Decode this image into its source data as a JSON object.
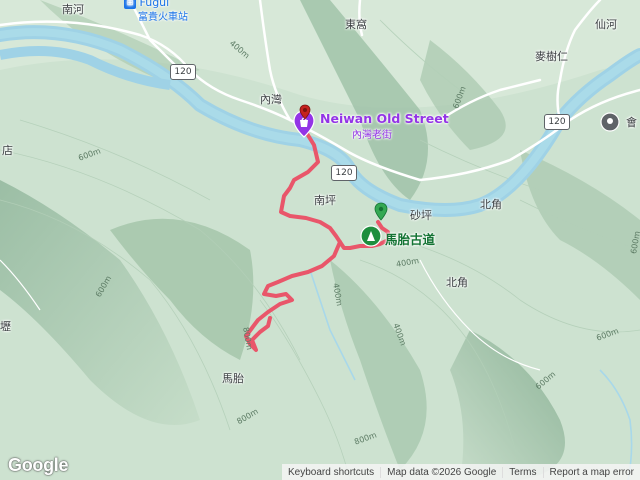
{
  "colors": {
    "trail": "#e9566a",
    "river": "#a8d8ea",
    "road": "#ffffff",
    "poi_accent": "#9334e6",
    "trail_marker": "#1e8e3e"
  },
  "labels": {
    "nanhe": "南河",
    "fugui_en": "Fugui",
    "fugui_zh": "富貴火車站",
    "dongwo": "東窩",
    "xianhe": "仙河",
    "maishuren": "麥樹仁",
    "neiwan": "內灣",
    "neiwan_old_street": "Neiwan Old Street",
    "neiwan_old_street_zh": "內灣老街",
    "nanping": "南坪",
    "shaping": "砂坪",
    "beijiao_1": "北角",
    "beijiao_2": "北角",
    "matai_trail": "馬胎古道",
    "matai": "馬胎",
    "dian": "店",
    "li": "壢",
    "hui": "會"
  },
  "roads": {
    "r120_a": "120",
    "r120_b": "120",
    "r120_c": "120"
  },
  "elevations": [
    "400m",
    "600m",
    "600m",
    "600m",
    "400m",
    "400m",
    "600m",
    "800m",
    "600m",
    "800m",
    "600m",
    "800m",
    "400m"
  ],
  "icons": {
    "train": "train-station-icon",
    "poi": "shopping-pin-icon",
    "trail": "hiking-trail-icon",
    "place": "place-pin-icon"
  },
  "branding": {
    "logo": "Google"
  },
  "attribution": {
    "shortcuts": "Keyboard shortcuts",
    "map_data": "Map data ©2026 Google",
    "terms": "Terms",
    "report": "Report a map error"
  }
}
